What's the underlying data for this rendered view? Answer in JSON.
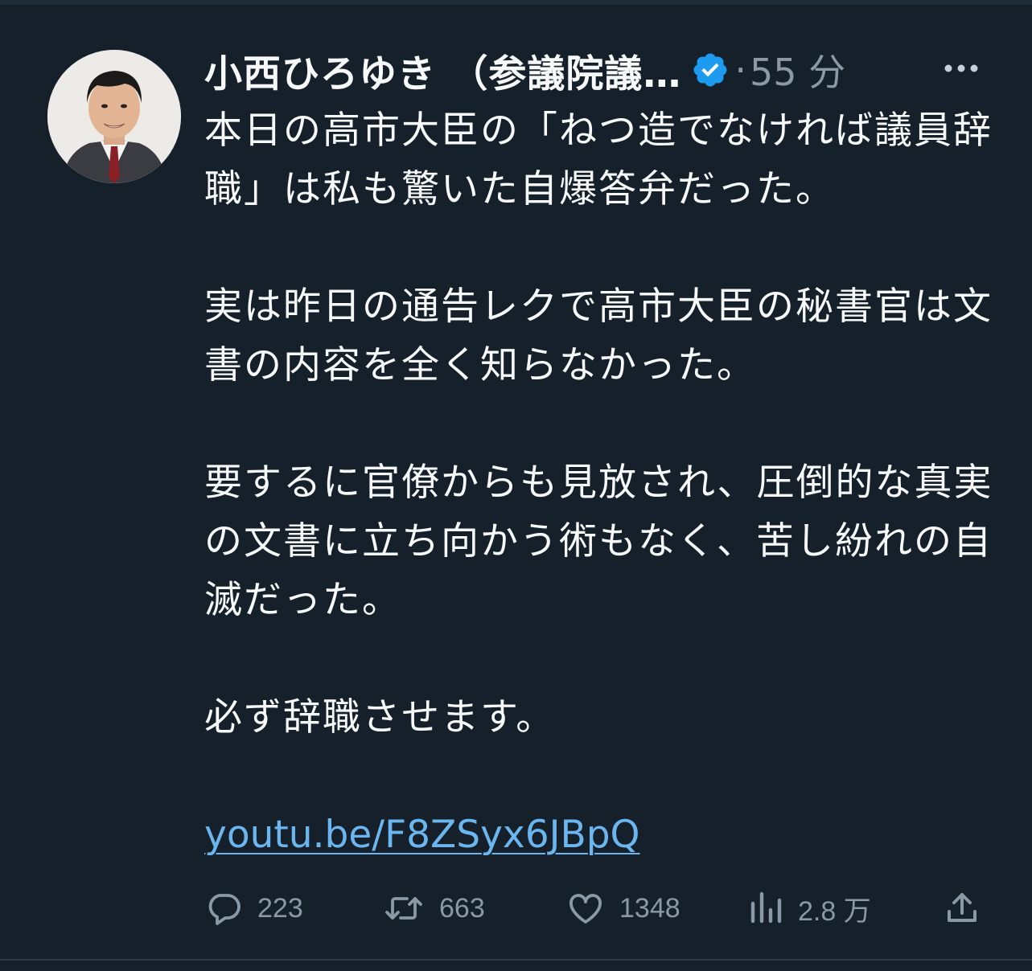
{
  "author": {
    "display_name": "小西ひろゆき （参議院議…",
    "verified": true,
    "separator": "·",
    "time": "55 分"
  },
  "tweet": {
    "paragraphs": [
      "本日の高市大臣の「ねつ造でなければ議員辞職」は私も驚いた自爆答弁だった。",
      "実は昨日の通告レクで高市大臣の秘書官は文書の内容を全く知らなかった。",
      "要するに官僚からも見放され、圧倒的な真実の文書に立ち向かう術もなく、苦し紛れの自滅だった。",
      "必ず辞職させます。"
    ],
    "link": "youtu.be/F8ZSyx6JBpQ"
  },
  "actions": {
    "replies": "223",
    "retweets": "663",
    "likes": "1348",
    "views": "2.8 万"
  },
  "colors": {
    "background": "#15202b",
    "text": "#f7f9f9",
    "muted": "#8b98a5",
    "link": "#6cb6f0",
    "verified": "#1d9bf0"
  },
  "icons": {
    "verified": "verified-badge-icon",
    "more": "more-dots-icon",
    "reply": "reply-bubble-icon",
    "retweet": "retweet-arrows-icon",
    "like": "heart-icon",
    "views": "bar-chart-icon",
    "share": "share-upload-icon"
  }
}
